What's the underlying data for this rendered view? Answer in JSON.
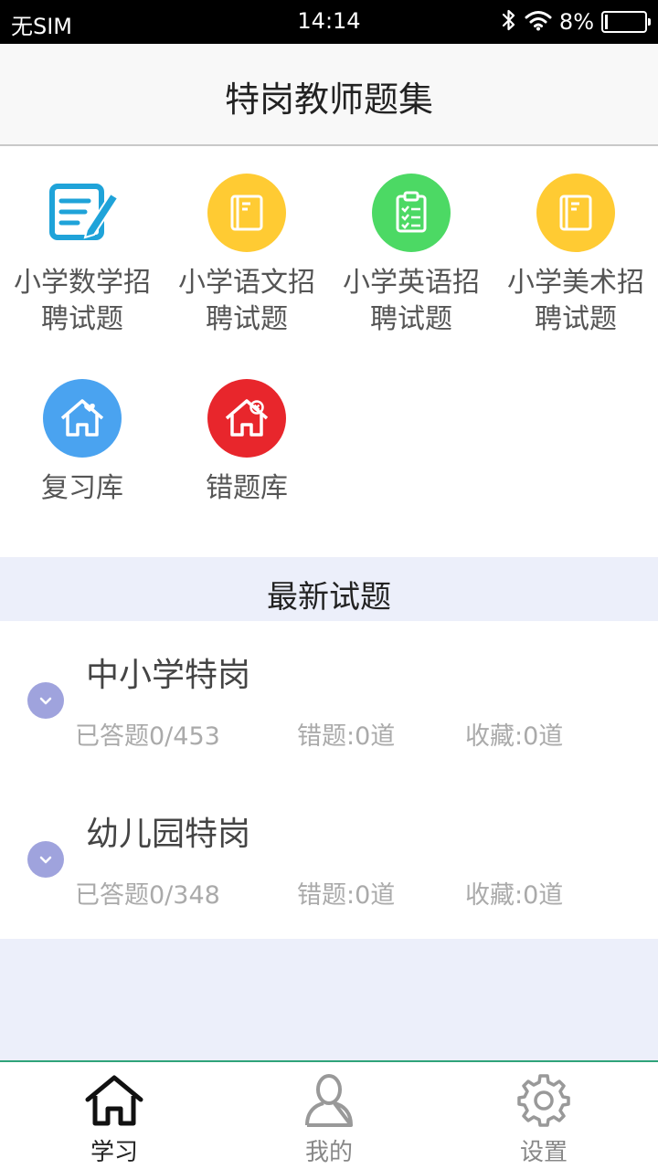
{
  "status_bar": {
    "carrier": "无SIM",
    "time": "14:14",
    "battery": "8%",
    "battery_level": 0.08
  },
  "header": {
    "title": "特岗教师题集"
  },
  "categories": [
    {
      "label": "小学数学招聘试题",
      "icon": "notepad-pen-icon",
      "color": "#1fa3d9"
    },
    {
      "label": "小学语文招聘试题",
      "icon": "book-icon",
      "color": "#ffcb33"
    },
    {
      "label": "小学英语招聘试题",
      "icon": "clipboard-checklist-icon",
      "color": "#4cd964"
    },
    {
      "label": "小学美术招聘试题",
      "icon": "book-icon",
      "color": "#ffcb33"
    },
    {
      "label": "复习库",
      "icon": "house-heart-icon",
      "color": "#4aa3f0"
    },
    {
      "label": "错题库",
      "icon": "house-x-icon",
      "color": "#e8262c"
    }
  ],
  "section": {
    "title": "最新试题"
  },
  "exams": [
    {
      "title": "中小学特岗",
      "answered": "已答题0/453",
      "wrong": "错题:0道",
      "favorites": "收藏:0道"
    },
    {
      "title": "幼儿园特岗",
      "answered": "已答题0/348",
      "wrong": "错题:0道",
      "favorites": "收藏:0道"
    }
  ],
  "tabs": [
    {
      "label": "学习",
      "icon": "home-icon",
      "active": true
    },
    {
      "label": "我的",
      "icon": "person-icon",
      "active": false
    },
    {
      "label": "设置",
      "icon": "gear-icon",
      "active": false
    }
  ]
}
